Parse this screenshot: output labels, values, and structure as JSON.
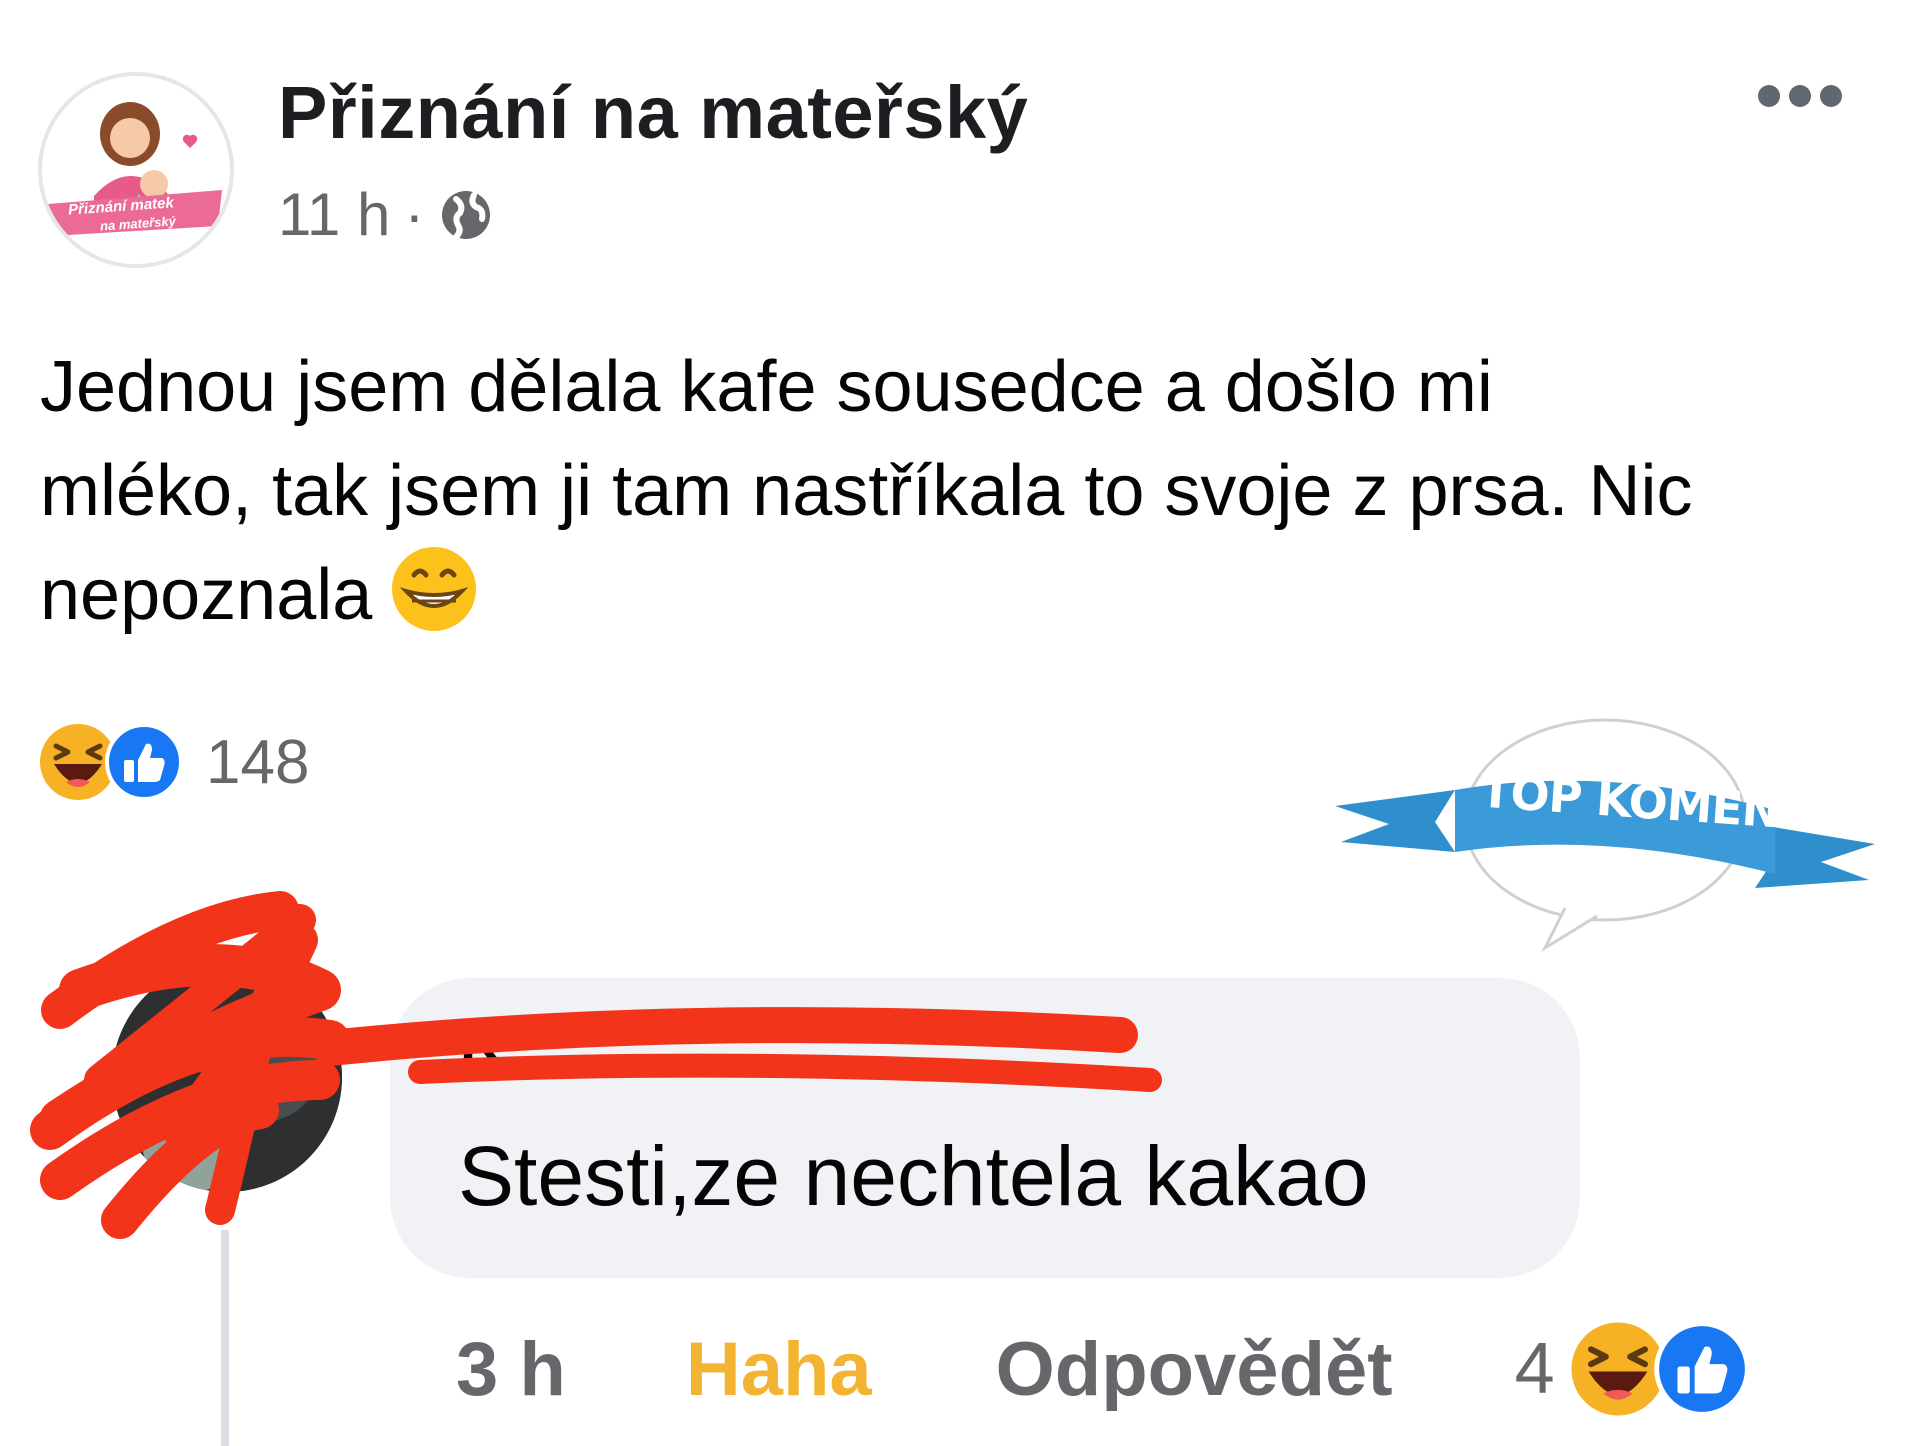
{
  "post": {
    "page_name": "Přiznání na mateřský",
    "time": "11 h",
    "separator": "·",
    "audience_icon": "globe-icon",
    "avatar_text_line1": "Přiznání matek",
    "avatar_text_line2": "na mateřský",
    "text_lines": [
      "Jednou jsem dělala kafe sousedce a došlo mi",
      "mléko, tak jsem ji tam nastříkala to svoje z prsa. Nic",
      "nepoznala"
    ],
    "text_emoji": "beaming-face-emoji",
    "reactions": {
      "icons": [
        "haha-reaction-icon",
        "like-reaction-icon"
      ],
      "count": "148"
    }
  },
  "badge": {
    "label": "TOP KOMENTY"
  },
  "comment": {
    "author": "K",
    "text": "Stesti,ze nechtela kakao",
    "time": "3 h",
    "reaction_action": "Haha",
    "reply_action": "Odpovědět",
    "reactions": {
      "count": "4",
      "icons": [
        "haha-reaction-icon",
        "like-reaction-icon"
      ]
    }
  },
  "colors": {
    "haha_yellow": "#f2b432",
    "like_blue": "#1877f2",
    "badge_blue": "#2f8fcc",
    "scribble_red": "#f2341a",
    "secondary_text": "#65676b"
  }
}
